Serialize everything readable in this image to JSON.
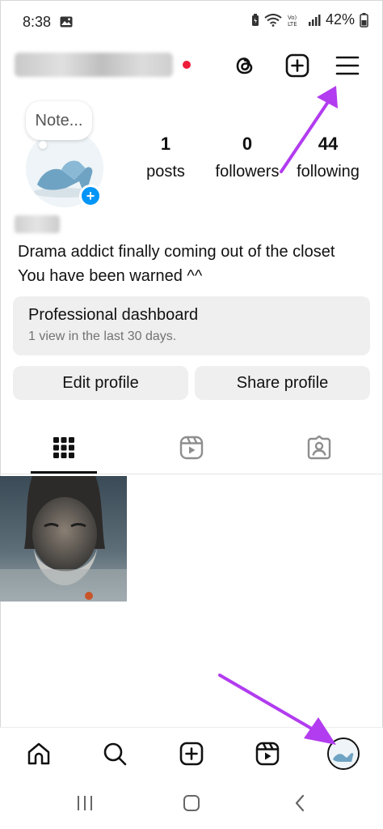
{
  "status_bar": {
    "time": "8:38",
    "battery": "42%",
    "icons": [
      "photo-icon",
      "battery-saver-icon",
      "wifi-icon",
      "volte-icon",
      "signal-icon",
      "battery-icon"
    ]
  },
  "header": {
    "username": "",
    "icons": [
      "threads-icon",
      "create-icon",
      "menu-icon"
    ]
  },
  "profile": {
    "note_label": "Note...",
    "stats": [
      {
        "value": "1",
        "label": "posts"
      },
      {
        "value": "0",
        "label": "followers"
      },
      {
        "value": "44",
        "label": "following"
      }
    ],
    "bio_lines": [
      "Drama addict finally coming out of the closet",
      "You have been warned ^^"
    ]
  },
  "dashboard": {
    "title": "Professional dashboard",
    "subtitle": "1 view in the last 30 days."
  },
  "buttons": {
    "edit": "Edit profile",
    "share": "Share profile"
  },
  "tabs": [
    "grid-icon",
    "reels-icon",
    "tagged-icon"
  ],
  "bottom_nav": [
    "home-icon",
    "search-icon",
    "create-icon",
    "reels-icon",
    "profile-avatar"
  ],
  "colors": {
    "accent_blue": "#0095f6",
    "live_dot": "#ee1d3a",
    "arrow": "#b23cf0",
    "button_bg": "#efefef"
  }
}
